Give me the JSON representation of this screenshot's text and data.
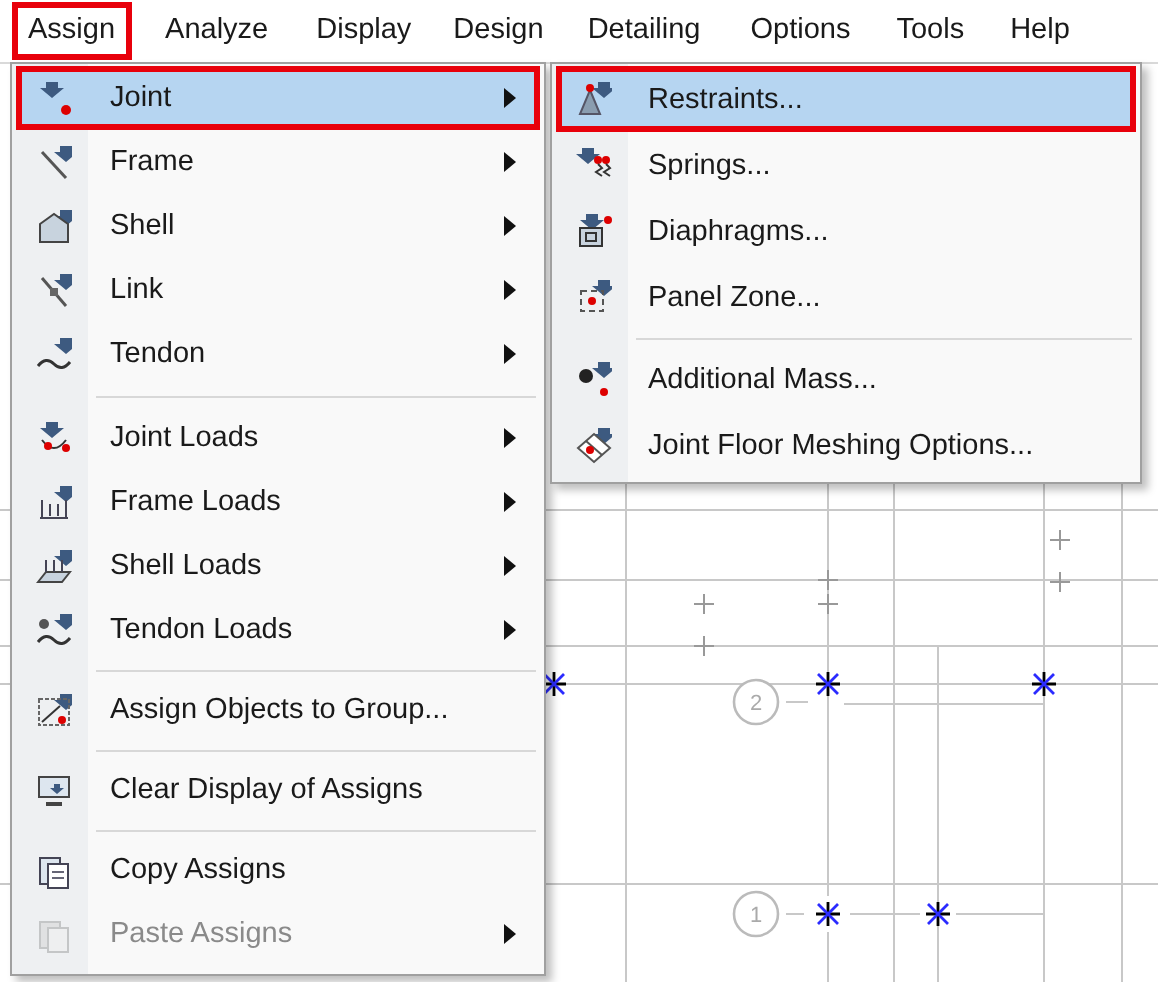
{
  "menu_bar": [
    {
      "label": "Assign",
      "outlined": true
    },
    {
      "label": "Analyze",
      "outlined": false
    },
    {
      "label": "Display",
      "outlined": false
    },
    {
      "label": "Design",
      "outlined": false
    },
    {
      "label": "Detailing",
      "outlined": false
    },
    {
      "label": "Options",
      "outlined": false
    },
    {
      "label": "Tools",
      "outlined": false
    },
    {
      "label": "Help",
      "outlined": false
    }
  ],
  "assign_menu": [
    {
      "kind": "item",
      "label": "Joint",
      "selected": true,
      "outlined": true,
      "submenu": true,
      "disabled": false
    },
    {
      "kind": "item",
      "label": "Frame",
      "selected": false,
      "outlined": false,
      "submenu": true,
      "disabled": false
    },
    {
      "kind": "item",
      "label": "Shell",
      "selected": false,
      "outlined": false,
      "submenu": true,
      "disabled": false
    },
    {
      "kind": "item",
      "label": "Link",
      "selected": false,
      "outlined": false,
      "submenu": true,
      "disabled": false
    },
    {
      "kind": "item",
      "label": "Tendon",
      "selected": false,
      "outlined": false,
      "submenu": true,
      "disabled": false
    },
    {
      "kind": "separator"
    },
    {
      "kind": "item",
      "label": "Joint Loads",
      "selected": false,
      "outlined": false,
      "submenu": true,
      "disabled": false
    },
    {
      "kind": "item",
      "label": "Frame Loads",
      "selected": false,
      "outlined": false,
      "submenu": true,
      "disabled": false
    },
    {
      "kind": "item",
      "label": "Shell Loads",
      "selected": false,
      "outlined": false,
      "submenu": true,
      "disabled": false
    },
    {
      "kind": "item",
      "label": "Tendon Loads",
      "selected": false,
      "outlined": false,
      "submenu": true,
      "disabled": false
    },
    {
      "kind": "separator"
    },
    {
      "kind": "item",
      "label": "Assign Objects to Group...",
      "selected": false,
      "outlined": false,
      "submenu": false,
      "disabled": false
    },
    {
      "kind": "separator"
    },
    {
      "kind": "item",
      "label": "Clear Display of Assigns",
      "selected": false,
      "outlined": false,
      "submenu": false,
      "disabled": false
    },
    {
      "kind": "separator"
    },
    {
      "kind": "item",
      "label": "Copy Assigns",
      "selected": false,
      "outlined": false,
      "submenu": false,
      "disabled": false
    },
    {
      "kind": "item",
      "label": "Paste Assigns",
      "selected": false,
      "outlined": false,
      "submenu": true,
      "disabled": true
    }
  ],
  "joint_submenu": [
    {
      "kind": "item",
      "label": "Restraints...",
      "selected": true,
      "outlined": true
    },
    {
      "kind": "item",
      "label": "Springs...",
      "selected": false,
      "outlined": false
    },
    {
      "kind": "item",
      "label": "Diaphragms...",
      "selected": false,
      "outlined": false
    },
    {
      "kind": "item",
      "label": "Panel Zone...",
      "selected": false,
      "outlined": false
    },
    {
      "kind": "separator"
    },
    {
      "kind": "item",
      "label": "Additional Mass...",
      "selected": false,
      "outlined": false
    },
    {
      "kind": "item",
      "label": "Joint Floor Meshing Options...",
      "selected": false,
      "outlined": false
    }
  ],
  "canvas": {
    "grid_labels": [
      "2",
      "1"
    ]
  }
}
